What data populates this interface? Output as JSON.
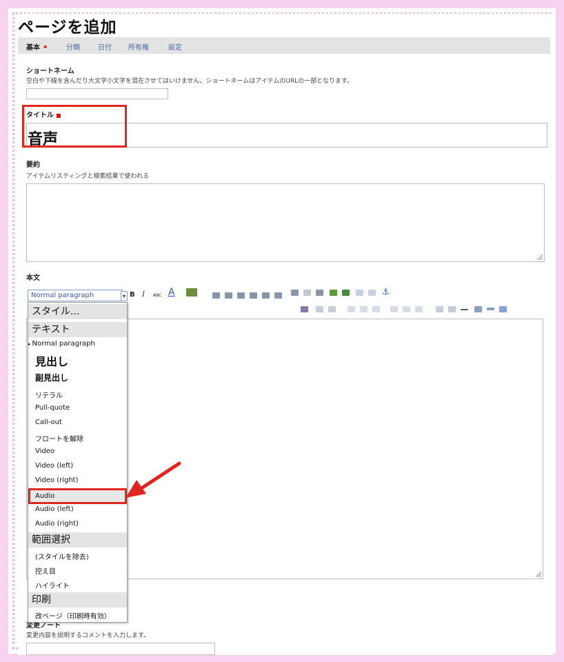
{
  "page": {
    "title": "ページを追加"
  },
  "tabs": [
    {
      "label": "基本",
      "required": "•"
    },
    {
      "label": "分類"
    },
    {
      "label": "日付"
    },
    {
      "label": "所有権"
    },
    {
      "label": "設定"
    }
  ],
  "shortname": {
    "label": "ショートネーム",
    "help": "空白や下線を含んだり大文字小文字を混在させてはいけません。ショートネームはアイテムのURLの一部となります。",
    "value": ""
  },
  "title_field": {
    "label": "タイトル",
    "required": "■",
    "value": "音声"
  },
  "summary": {
    "label": "要約",
    "help": "アイテムリスティングと検索結果で使われる",
    "value": ""
  },
  "body": {
    "label": "本文",
    "format_select": "Normal paragraph",
    "toolbar": {
      "bold": "B",
      "italic": "I",
      "abc": "ABC",
      "font_color": "A"
    }
  },
  "style_menu": {
    "items": [
      {
        "label": "スタイル...",
        "kind": "head"
      },
      {
        "label": "テキスト",
        "kind": "head"
      },
      {
        "label": "Normal paragraph",
        "kind": "selected"
      },
      {
        "label": "見出し",
        "kind": "h2"
      },
      {
        "label": "副見出し",
        "kind": "h3"
      },
      {
        "label": "リテラル",
        "kind": "item"
      },
      {
        "label": "Pull-quote",
        "kind": "item"
      },
      {
        "label": "Call-out",
        "kind": "item"
      },
      {
        "label": "フロートを解除",
        "kind": "item"
      },
      {
        "label": "Video",
        "kind": "item"
      },
      {
        "label": "Video (left)",
        "kind": "item"
      },
      {
        "label": "Video (right)",
        "kind": "item"
      },
      {
        "label": "Audio",
        "kind": "highlight"
      },
      {
        "label": "Audio (left)",
        "kind": "item"
      },
      {
        "label": "Audio (right)",
        "kind": "item"
      },
      {
        "label": "範囲選択",
        "kind": "head"
      },
      {
        "label": "(スタイルを除去)",
        "kind": "item"
      },
      {
        "label": "控え目",
        "kind": "item"
      },
      {
        "label": "ハイライト",
        "kind": "item"
      },
      {
        "label": "印刷",
        "kind": "head"
      },
      {
        "label": "改ページ（印刷時有効）",
        "kind": "item"
      }
    ]
  },
  "change_note": {
    "label": "変更ノート",
    "help": "変更内容を説明するコメントを入力します。",
    "value": ""
  },
  "colors": {
    "highlight": "#e12620",
    "frame": "#f7d3ef",
    "tabs_bg": "#e3e3e3",
    "link": "#4a6aa8"
  }
}
